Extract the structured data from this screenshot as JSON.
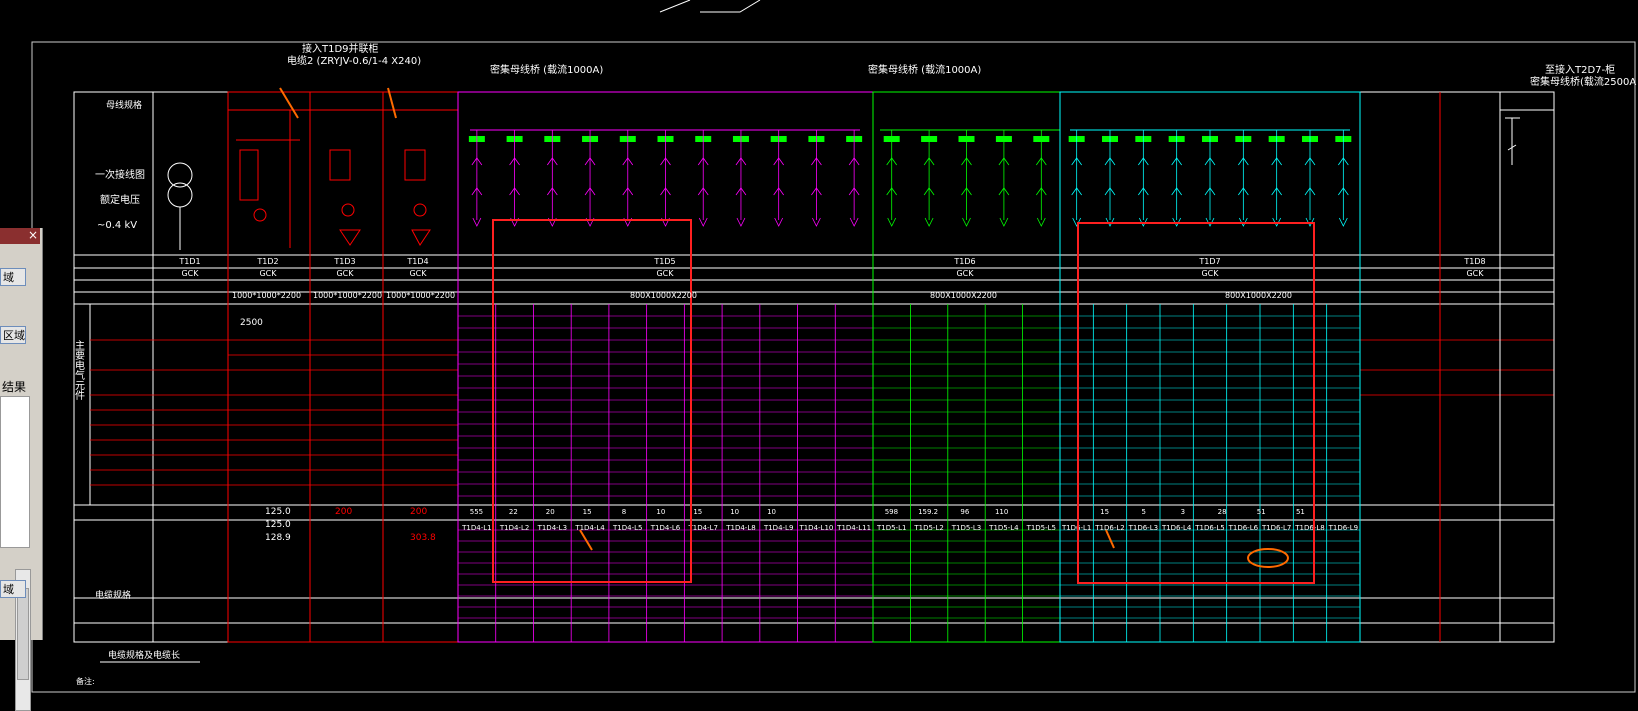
{
  "drawing": {
    "top_note_1": "接入T1D9并联柜",
    "top_note_2": "电缆2 (ZRYJV-0.6/1-4 X240)",
    "busbar_left": "密集母线桥 (载流1000A)",
    "busbar_mid": "密集母线桥 (载流1000A)",
    "right_note_1": "至接入T2D7-柜",
    "right_note_2": "密集母线桥(载流2500A",
    "row_headers": [
      "母线规格",
      "一次接线图",
      "额定电压",
      "~0.4 kV"
    ],
    "transformer": "T1",
    "cabinet_ids": [
      "T1D1",
      "T1D2",
      "T1D3",
      "T1D4",
      "T1D5",
      "T1D6",
      "T1D7",
      "T1D8"
    ],
    "cabinet_type": "GCK",
    "section_totals": [
      "800X1000X2200",
      "800X1000X2200",
      "800X1000X2200"
    ],
    "dim_row": [
      "1000*1000*2200",
      "1000*1000*2200",
      "1000*1000*2200"
    ],
    "left_param_label": "主要电气元件",
    "bottom_label": "电缆规格",
    "footer_label": "电缆规格及电缆长",
    "note_label": "备注:",
    "cap_label": "2500",
    "circuit_labels_magenta": [
      "T1D4-L1",
      "T1D4-L2",
      "T1D4-L3",
      "T1D4-L4",
      "T1D4-L5",
      "T1D4-L6",
      "T1D4-L7",
      "T1D4-L8",
      "T1D4-L9",
      "T1D4-L10",
      "T1D4-L11"
    ],
    "circuit_labels_green": [
      "T1D5-L1",
      "T1D5-L2",
      "T1D5-L3",
      "T1D5-L4",
      "T1D5-L5"
    ],
    "circuit_labels_cyan": [
      "T1D6-L1",
      "T1D6-L2",
      "T1D6-L3",
      "T1D6-L4",
      "T1D6-L5",
      "T1D6-L6",
      "T1D6-L7",
      "T1D6-L8",
      "T1D6-L9"
    ],
    "values_row_magenta": [
      "555",
      "22",
      "20",
      "15",
      "8",
      "10",
      "15",
      "10",
      "10"
    ],
    "values_row_green": [
      "598",
      "159.2",
      "96",
      "110"
    ],
    "values_row_cyan": [
      "15",
      "5",
      "3",
      "28",
      "51",
      "51"
    ],
    "left_block_values": [
      "125.0",
      "125.0",
      "128.9"
    ],
    "col_values_red": [
      "200",
      "200",
      "303.8"
    ]
  },
  "panel": {
    "close_label": "×",
    "btn1": "域",
    "btn2": "区域",
    "result_label": "结果",
    "btn3": "域"
  },
  "colors": {
    "magenta": "#ff00ff",
    "green": "#00ff00",
    "cyan": "#00ffff",
    "red": "#ff0000",
    "white": "#ffffff",
    "orange_mark": "#ff6a00"
  }
}
